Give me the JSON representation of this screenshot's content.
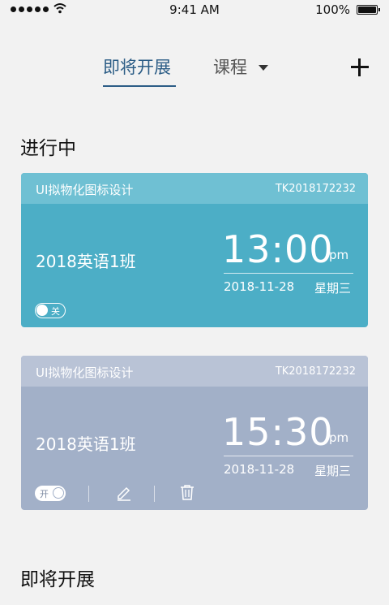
{
  "status_bar": {
    "time": "9:41 AM",
    "battery": "100%"
  },
  "nav": {
    "tab_upcoming": "即将开展",
    "tab_course": "课程"
  },
  "sections": {
    "in_progress": "进行中",
    "upcoming": "即将开展"
  },
  "cards": [
    {
      "course": "UI拟物化图标设计",
      "code": "TK2018172232",
      "class_name": "2018英语1班",
      "time": "13:00",
      "ampm": "pm",
      "date": "2018-11-28",
      "weekday": "星期三",
      "toggle_label": "关",
      "toggle_state": "off",
      "color": "#4caec6"
    },
    {
      "course": "UI拟物化图标设计",
      "code": "TK2018172232",
      "class_name": "2018英语1班",
      "time": "15:30",
      "ampm": "pm",
      "date": "2018-11-28",
      "weekday": "星期三",
      "toggle_label": "开",
      "toggle_state": "on",
      "color": "#a2b0c8"
    }
  ],
  "accent": "#2c5d86"
}
